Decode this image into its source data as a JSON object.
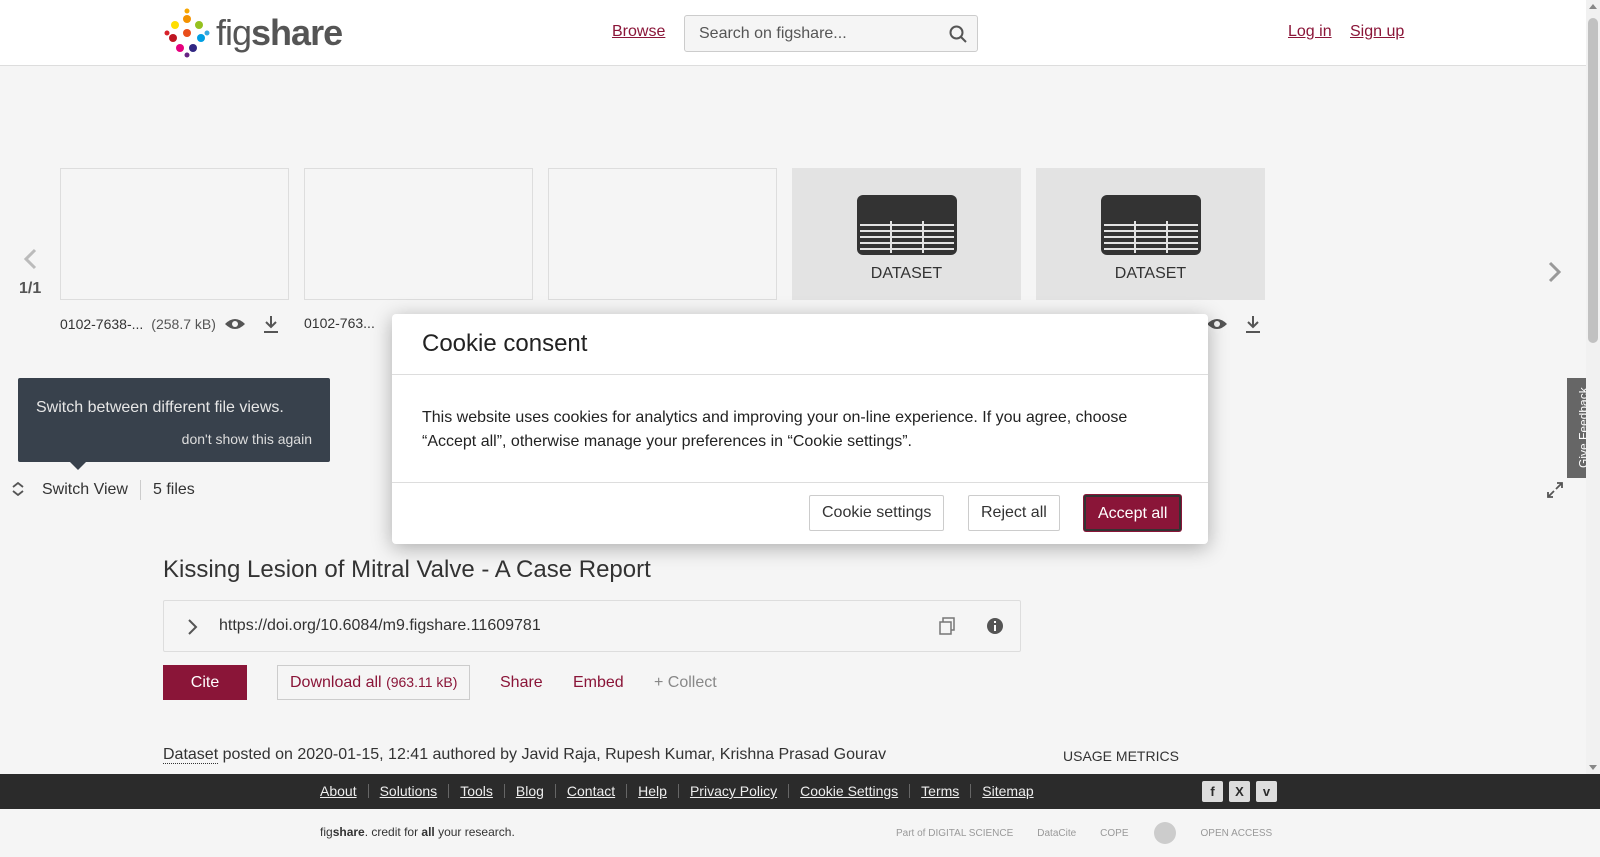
{
  "header": {
    "logo_text_light": "fig",
    "logo_text_bold": "share",
    "browse": "Browse",
    "search_placeholder": "Search on figshare...",
    "login": "Log in",
    "signup": "Sign up"
  },
  "viewer": {
    "pager": "1/1",
    "files": [
      {
        "name": "0102-7638-...",
        "size": "(258.7 kB)"
      },
      {
        "name": "0102-763..."
      }
    ],
    "dataset_label": "DATASET",
    "tooltip_text": "Switch between different file views.",
    "tooltip_dismiss": "don't show this again",
    "switch_view": "Switch View",
    "files_count": "5 files",
    "feedback": "Give Feedback"
  },
  "article": {
    "title": "Kissing Lesion of Mitral Valve - A Case Report",
    "doi": "https://doi.org/10.6084/m9.figshare.11609781",
    "cite": "Cite",
    "download_all": "Download all",
    "download_size": "(963.11 kB)",
    "share": "Share",
    "embed": "Embed",
    "collect": "+ Collect",
    "dataset_type": "Dataset",
    "posted_text": " posted on 2020-01-15, 12:41 authored by Javid Raja, Rupesh Kumar, Krishna Prasad Gourav",
    "usage_metrics": "USAGE METRICS"
  },
  "footer": {
    "links": [
      "About",
      "Solutions",
      "Tools",
      "Blog",
      "Contact",
      "Help",
      "Privacy Policy",
      "Cookie Settings",
      "Terms",
      "Sitemap"
    ],
    "social": [
      "f",
      "X",
      "v"
    ],
    "credit_prefix": "fig",
    "credit_bold": "share",
    "credit_mid": ". credit for ",
    "credit_all": "all",
    "credit_end": " your research.",
    "partners": [
      "Part of DIGITAL SCIENCE",
      "DataCite",
      "COPE",
      "",
      "OPEN ACCESS"
    ]
  },
  "cookie_modal": {
    "title": "Cookie consent",
    "body": "This website uses cookies for analytics and improving your on-line experience. If you agree, choose “Accept all”, otherwise manage your preferences in “Cookie settings”.",
    "settings": "Cookie settings",
    "reject": "Reject all",
    "accept": "Accept all"
  },
  "colors": {
    "brand": "#8a1538",
    "footer_dark": "#2b2b2b",
    "tooltip_bg": "#38414c"
  }
}
